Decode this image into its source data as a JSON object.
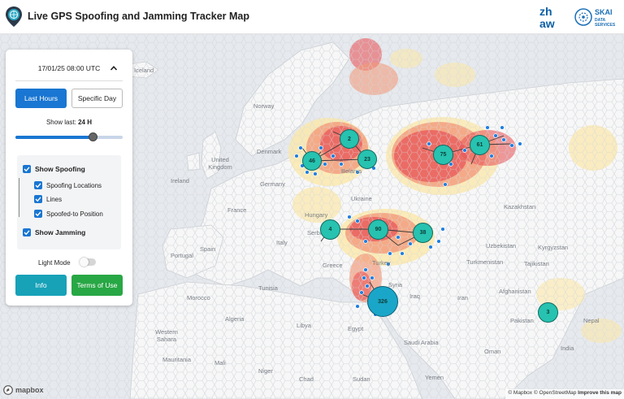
{
  "header": {
    "title": "Live GPS Spoofing and Jamming Tracker Map",
    "brand_logos": [
      "zhaw",
      "SKAI DATA SERVICES"
    ],
    "zhaw_text": "zh aw",
    "skai_lines": [
      "SKAI",
      "DATA",
      "SERVICES"
    ]
  },
  "panel": {
    "datetime": "17/01/25 08:00 UTC",
    "last_hours_label": "Last Hours",
    "specific_day_label": "Specific Day",
    "show_last_prefix": "Show last:",
    "show_last_value": "24 H",
    "slider_fraction": 0.72,
    "show_spoofing_label": "Show Spoofing",
    "spoofing_locations_label": "Spoofing Locations",
    "lines_label": "Lines",
    "spoofed_position_label": "Spoofed-to Position",
    "show_jamming_label": "Show Jamming",
    "light_mode_label": "Light Mode",
    "info_label": "Info",
    "terms_label": "Terms of Use",
    "checkboxes": {
      "show_spoofing": true,
      "spoofing_locations": true,
      "lines": true,
      "spoofed_position": true,
      "show_jamming": true
    },
    "light_mode": false
  },
  "map": {
    "clusters": [
      {
        "id": "46",
        "label": "46"
      },
      {
        "id": "2",
        "label": "2"
      },
      {
        "id": "23",
        "label": "23"
      },
      {
        "id": "75",
        "label": "75"
      },
      {
        "id": "61",
        "label": "61"
      },
      {
        "id": "4",
        "label": "4"
      },
      {
        "id": "90",
        "label": "90"
      },
      {
        "id": "38",
        "label": "38"
      },
      {
        "id": "326",
        "label": "326"
      },
      {
        "id": "3",
        "label": "3"
      }
    ],
    "places": {
      "iceland": "Iceland",
      "norway": "Norway",
      "denmark": "Denmark",
      "united_kingdom": "United Kingdom",
      "ireland": "Ireland",
      "germany": "Germany",
      "france": "France",
      "spain": "Spain",
      "portugal": "Portugal",
      "italy": "Italy",
      "hungary": "Hungary",
      "greece": "Greece",
      "belarus": "Belarus",
      "ukraine": "Ukraine",
      "serbia": "Serbia",
      "turkey": "Turkey",
      "syria": "Syria",
      "iraq": "Iraq",
      "iran": "Iran",
      "egypt": "Egypt",
      "libya": "Libya",
      "algeria": "Algeria",
      "morocco": "Morocco",
      "tunisia": "Tunisia",
      "western_sahara": "Western Sahara",
      "mauritania": "Mauritania",
      "mali": "Mali",
      "niger": "Niger",
      "chad": "Chad",
      "sudan": "Sudan",
      "saudi_arabia": "Saudi Arabia",
      "yemen": "Yemen",
      "oman": "Oman",
      "kazakhstan": "Kazakhstan",
      "uzbekistan": "Uzbekistan",
      "turkmenistan": "Turkmenistan",
      "kyrgyzstan": "Kyrgyzstan",
      "tajikistan": "Tajikistan",
      "afghanistan": "Afghanistan",
      "pakistan": "Pakistan",
      "nepal": "Nepal",
      "india": "India"
    }
  },
  "footer": {
    "mapbox_logo": "mapbox",
    "attribution_mapbox": "© Mapbox",
    "attribution_osm": "© OpenStreetMap",
    "improve": "Improve this map"
  },
  "colors": {
    "accent_blue": "#1976d2",
    "info_teal": "#17a2b8",
    "terms_green": "#28a745",
    "cluster_teal": "#27c2b0",
    "spoof_dot": "#1e7fe0",
    "jam_red": "#e8575a",
    "jam_orange": "#f29a7a",
    "jam_yellow": "#fbe7a8"
  }
}
